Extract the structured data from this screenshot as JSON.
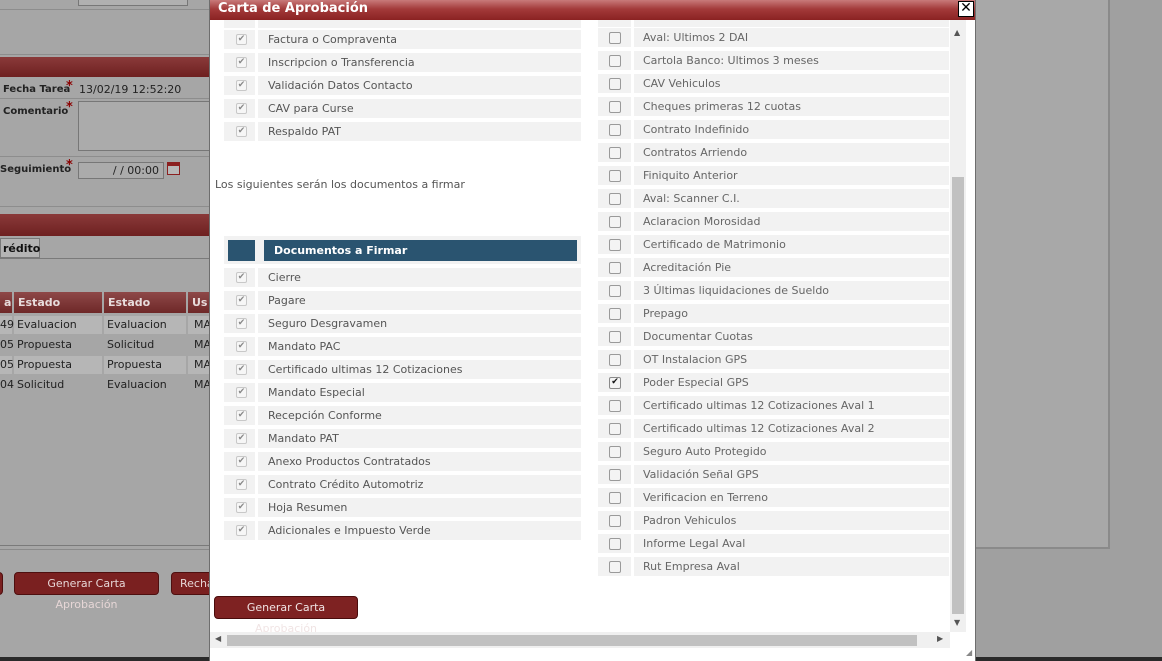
{
  "background": {
    "fecha_tarea_label": "Fecha Tarea",
    "fecha_tarea_value": "13/02/19 12:52:20",
    "comentario_label": "Comentario",
    "seguimiento_label": "Seguimiento",
    "seguimiento_value": "/ /   00:00",
    "required_mark": "*",
    "tab_label": "rédito",
    "table_headers": [
      "a",
      "Estado Anterior",
      "Estado Actual",
      "Us"
    ],
    "table_rows": [
      [
        "49",
        "Evaluacion",
        "Evaluacion",
        "MA"
      ],
      [
        "05",
        "Propuesta",
        "Solicitud",
        "MA"
      ],
      [
        "05",
        "Propuesta",
        "Propuesta",
        "MA"
      ],
      [
        "04",
        "Solicitud",
        "Evaluacion",
        "MA"
      ]
    ],
    "buttons": {
      "generar": "Generar Carta Aprobación",
      "rechazar": "Recha"
    }
  },
  "dialog": {
    "title": "Carta de Aprobación",
    "close_label": "✕",
    "left_top_items": [
      {
        "label": "Factura o Compraventa",
        "checked": true
      },
      {
        "label": "Inscripcion o Transferencia",
        "checked": true
      },
      {
        "label": "Validación Datos Contacto",
        "checked": true
      },
      {
        "label": "CAV para Curse",
        "checked": true
      },
      {
        "label": "Respaldo PAT",
        "checked": true
      }
    ],
    "info_text": "Los siguientes serán los documentos a firmar",
    "firmar_header": "Documentos a Firmar",
    "firmar_items": [
      {
        "label": "Cierre",
        "checked": true
      },
      {
        "label": "Pagare",
        "checked": true
      },
      {
        "label": "Seguro Desgravamen",
        "checked": true
      },
      {
        "label": "Mandato PAC",
        "checked": true
      },
      {
        "label": "Certificado ultimas 12 Cotizaciones",
        "checked": true
      },
      {
        "label": "Mandato Especial",
        "checked": true
      },
      {
        "label": "Recepción Conforme",
        "checked": true
      },
      {
        "label": "Mandato PAT",
        "checked": true
      },
      {
        "label": "Anexo Productos Contratados",
        "checked": true
      },
      {
        "label": "Contrato Crédito Automotriz",
        "checked": true
      },
      {
        "label": "Hoja Resumen",
        "checked": true
      },
      {
        "label": "Adicionales e Impuesto Verde",
        "checked": true
      }
    ],
    "right_items": [
      {
        "label": "Aval: Ultimos 2 DAI",
        "checked": false
      },
      {
        "label": "Cartola Banco: Ultimos 3 meses",
        "checked": false
      },
      {
        "label": "CAV Vehiculos",
        "checked": false
      },
      {
        "label": "Cheques primeras 12 cuotas",
        "checked": false
      },
      {
        "label": "Contrato Indefinido",
        "checked": false
      },
      {
        "label": "Contratos Arriendo",
        "checked": false
      },
      {
        "label": "Finiquito Anterior",
        "checked": false
      },
      {
        "label": "Aval: Scanner C.I.",
        "checked": false
      },
      {
        "label": "Aclaracion Morosidad",
        "checked": false
      },
      {
        "label": "Certificado de Matrimonio",
        "checked": false
      },
      {
        "label": "Acreditación Pie",
        "checked": false
      },
      {
        "label": "3 Últimas liquidaciones de Sueldo",
        "checked": false
      },
      {
        "label": "Prepago",
        "checked": false
      },
      {
        "label": "Documentar Cuotas",
        "checked": false
      },
      {
        "label": "OT Instalacion GPS",
        "checked": false
      },
      {
        "label": "Poder Especial GPS",
        "checked": true
      },
      {
        "label": "Certificado ultimas 12 Cotizaciones Aval 1",
        "checked": false
      },
      {
        "label": "Certificado ultimas 12 Cotizaciones Aval 2",
        "checked": false
      },
      {
        "label": "Seguro Auto Protegido",
        "checked": false
      },
      {
        "label": "Validación Señal GPS",
        "checked": false
      },
      {
        "label": "Verificacion en Terreno",
        "checked": false
      },
      {
        "label": "Padron Vehiculos",
        "checked": false
      },
      {
        "label": "Informe Legal Aval",
        "checked": false
      },
      {
        "label": "Rut Empresa Aval",
        "checked": false
      }
    ],
    "generate_button": "Generar Carta Aprobación",
    "check_glyph": "✔"
  },
  "colors": {
    "title_bar": "#a33a3a",
    "table_header": "#2a5470",
    "button": "#7e2222"
  }
}
